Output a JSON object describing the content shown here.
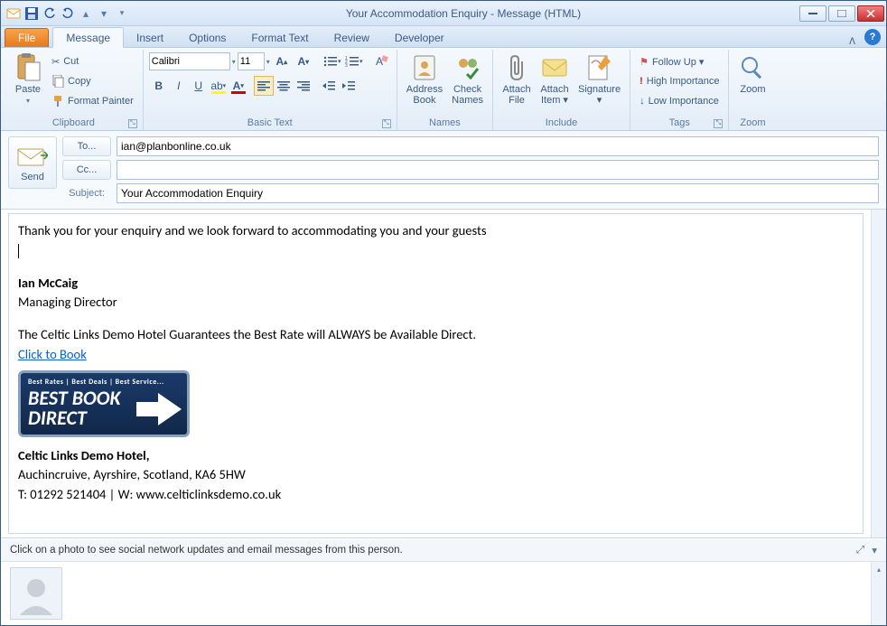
{
  "window": {
    "title": "Your Accommodation Enquiry  -  Message (HTML)"
  },
  "qat": {
    "save": "save-icon",
    "undo": "undo-icon",
    "redo": "redo-icon"
  },
  "tabs": {
    "file": "File",
    "items": [
      "Message",
      "Insert",
      "Options",
      "Format Text",
      "Review",
      "Developer"
    ],
    "active": 0
  },
  "ribbon": {
    "clipboard": {
      "label": "Clipboard",
      "paste": "Paste",
      "cut": "Cut",
      "copy": "Copy",
      "format_painter": "Format Painter"
    },
    "basic_text": {
      "label": "Basic Text",
      "font_name": "Calibri",
      "font_size": "11"
    },
    "names": {
      "label": "Names",
      "address_book": "Address\nBook",
      "check_names": "Check\nNames"
    },
    "include": {
      "label": "Include",
      "attach_file": "Attach\nFile",
      "attach_item": "Attach\nItem ▾",
      "signature": "Signature\n▾"
    },
    "tags": {
      "label": "Tags",
      "follow_up": "Follow Up ▾",
      "high_importance": "High Importance",
      "low_importance": "Low Importance"
    },
    "zoom": {
      "label": "Zoom",
      "zoom": "Zoom"
    }
  },
  "header": {
    "send": "Send",
    "to_label": "To...",
    "cc_label": "Cc...",
    "subject_label": "Subject:",
    "to_value": "ian@planbonline.co.uk",
    "cc_value": "",
    "subject_value": "Your Accommodation Enquiry"
  },
  "body": {
    "line1": "Thank you for your enquiry and we look forward to accommodating you and your guests",
    "sig_name": "Ian McCaig",
    "sig_title": "Managing Director",
    "guarantee": "The Celtic Links Demo Hotel Guarantees the Best Rate will ALWAYS be Available Direct.",
    "book_link": "Click to Book",
    "badge_top": "Best Rates | Best Deals | Best Service...",
    "badge_line1": "BEST BOOK",
    "badge_line2": "DIRECT",
    "hotel_name": "Celtic Links Demo Hotel,",
    "hotel_addr": "Auchincruive, Ayrshire, Scotland, KA6 5HW",
    "hotel_contact": "T: 01292 521404 | W: www.celticlinksdemo.co.uk"
  },
  "social": {
    "hint": "Click on a photo to see social network updates and email messages from this person."
  }
}
